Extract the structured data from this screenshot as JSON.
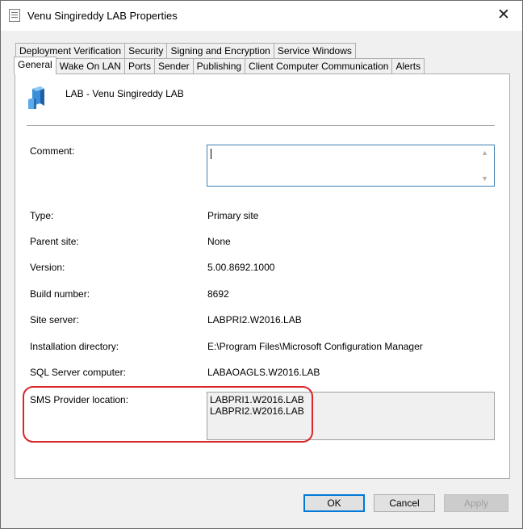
{
  "window": {
    "title": "Venu Singireddy LAB Properties",
    "close_glyph": "✕"
  },
  "tabs": {
    "row1": [
      "Deployment Verification",
      "Security",
      "Signing and Encryption",
      "Service Windows"
    ],
    "row2": [
      "General",
      "Wake On LAN",
      "Ports",
      "Sender",
      "Publishing",
      "Client Computer Communication",
      "Alerts"
    ],
    "active": "General"
  },
  "general": {
    "site_name": "LAB - Venu Singireddy LAB",
    "comment": {
      "label": "Comment:",
      "value": ""
    },
    "fields": [
      {
        "label": "Type:",
        "value": "Primary site"
      },
      {
        "label": "Parent site:",
        "value": "None"
      },
      {
        "label": "Version:",
        "value": "5.00.8692.1000"
      },
      {
        "label": "Build number:",
        "value": "8692"
      },
      {
        "label": "Site server:",
        "value": "LABPRI2.W2016.LAB"
      },
      {
        "label": "Installation directory:",
        "value": "E:\\Program Files\\Microsoft Configuration Manager"
      },
      {
        "label": "SQL Server computer:",
        "value": "LABAOAGLS.W2016.LAB"
      }
    ],
    "sms_provider": {
      "label": "SMS Provider location:",
      "values": [
        "LABPRI1.W2016.LAB",
        "LABPRI2.W2016.LAB"
      ]
    }
  },
  "buttons": {
    "ok": "OK",
    "cancel": "Cancel",
    "apply": "Apply"
  },
  "colors": {
    "highlight": "#d9262b",
    "focus": "#0078d7"
  },
  "icons": {
    "app": "properties-dialog-icon",
    "site": "site-server-icon",
    "close": "close-icon"
  }
}
